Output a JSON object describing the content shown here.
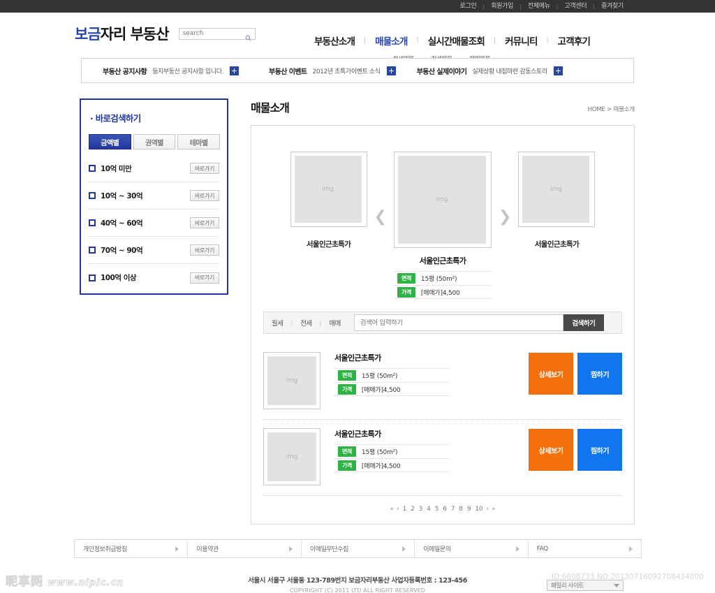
{
  "topbar": {
    "links": [
      "로그인",
      "회원가입",
      "전체메뉴",
      "고객센터",
      "즐겨찾기"
    ],
    "separator": "|"
  },
  "header": {
    "logo_blue": "보금",
    "logo_dark": "자리 부동산",
    "search_placeholder": "search",
    "search_value": "",
    "search_icon": "search-icon"
  },
  "gnb": {
    "separator": "|",
    "items": [
      {
        "label": "부동산소개",
        "active": false
      },
      {
        "label": "매물소개",
        "active": true
      },
      {
        "label": "실시간매물조회",
        "active": false
      },
      {
        "label": "커뮤니티",
        "active": false
      },
      {
        "label": "고객후기",
        "active": false
      }
    ],
    "sub_items": [
      "월세매물",
      "전세매물",
      "매매매물"
    ]
  },
  "notices": [
    {
      "title": "부동산 공지사항",
      "text": "둥지부동산 공지사항 입니다.",
      "plus": "+"
    },
    {
      "title": "부동산 이벤트",
      "text": "2012년 초특가이벤트 소식",
      "plus": "+"
    },
    {
      "title": "부동산 실제이야기",
      "text": "실제상황 내집마련 감동스토리",
      "plus": "+"
    }
  ],
  "sidebar": {
    "title": "· 바로검색하기",
    "tabs": [
      {
        "label": "금액별",
        "active": true
      },
      {
        "label": "권역별",
        "active": false
      },
      {
        "label": "테마별",
        "active": false
      }
    ],
    "items": [
      {
        "label": "10억 미만",
        "button": "바로가기"
      },
      {
        "label": "10억 ~ 30억",
        "button": "바로가기"
      },
      {
        "label": "40억 ~ 60억",
        "button": "바로가기"
      },
      {
        "label": "70억 ~ 90억",
        "button": "바로가기"
      },
      {
        "label": "100억 이상",
        "button": "바로가기"
      }
    ]
  },
  "content": {
    "page_title": "매물소개",
    "breadcrumb": "HOME > 매물소개",
    "carousel": {
      "prev_arrow": "❮",
      "next_arrow": "❯",
      "img_placeholder": "img",
      "left": {
        "caption": "서울인근초특가"
      },
      "right": {
        "caption": "서울인근초특가"
      },
      "center": {
        "caption": "서울인근초특가",
        "specs": [
          {
            "tag": "면적",
            "value": "15평 (50m²)"
          },
          {
            "tag": "가격",
            "value": "[매매가]4,500"
          }
        ]
      }
    },
    "filterbar": {
      "tabs": [
        "월세",
        "전세",
        "매매"
      ],
      "separator": "|",
      "input_placeholder": "검색어 입력하기",
      "input_value": "",
      "search_button": "검색하기"
    },
    "listings": [
      {
        "img_placeholder": "img",
        "name": "서울인근초특가",
        "specs": [
          {
            "tag": "면적",
            "value": "15평 (50m²)"
          },
          {
            "tag": "가격",
            "value": "[매매가]4,500"
          }
        ],
        "detail_button": "상세보기",
        "like_button": "찜하기"
      },
      {
        "img_placeholder": "img",
        "name": "서울인근초특가",
        "specs": [
          {
            "tag": "면적",
            "value": "15평 (50m²)"
          },
          {
            "tag": "가격",
            "value": "[매매가]4,500"
          }
        ],
        "detail_button": "상세보기",
        "like_button": "찜하기"
      }
    ],
    "pagination": {
      "first": "«",
      "prev": "‹",
      "pages": [
        "1",
        "2",
        "3",
        "4",
        "5",
        "6",
        "7",
        "8",
        "9",
        "10"
      ],
      "next": "›",
      "last": "»"
    }
  },
  "footer": {
    "nav": [
      "개인정보취급방침",
      "이용약관",
      "이메일무단수집",
      "이메일문의",
      "FAQ"
    ],
    "address": "서울시 서울구 서울동 123-789번지 보금자리부동산 사업자등록번호 : 123-456",
    "copyright": "COPYRIGHT (C) 2011 LTD ALL RIGHT RESERVED",
    "family_site": "패밀리 사이트"
  },
  "watermarks": {
    "left_cn": "昵享网",
    "left_url": "www.nipic.cn",
    "right_id": "ID:6608733 NO:20130716092708434000"
  },
  "colors": {
    "brand_blue": "#2546a8",
    "sidebar_border": "#2135a0",
    "tag_green": "#2fb346",
    "detail_orange": "#f4700a",
    "like_blue": "#1076f0",
    "topbar_dark": "#333333"
  }
}
